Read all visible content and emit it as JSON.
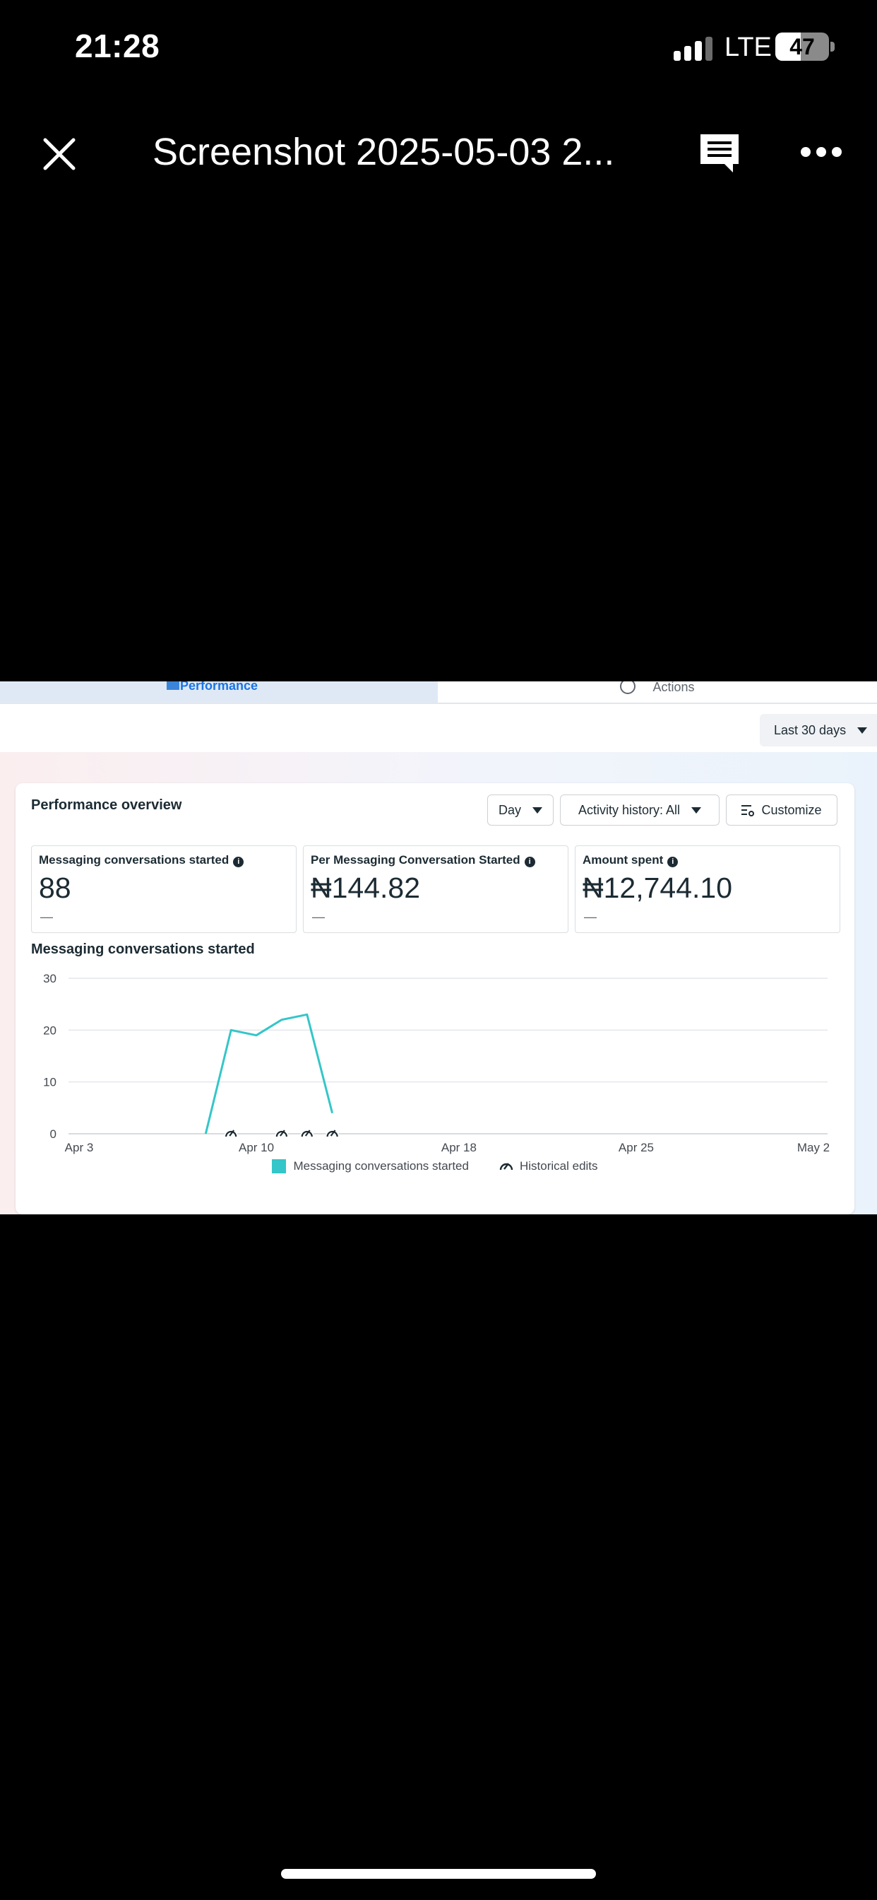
{
  "status_bar": {
    "time": "21:28",
    "network": "LTE",
    "battery": "47",
    "battery_level_pct": 47
  },
  "viewer": {
    "title": "Screenshot 2025-05-03 2...",
    "icons": [
      "close-icon",
      "comment-icon",
      "more-icon"
    ]
  },
  "tabs": [
    {
      "label": "Performance",
      "icon": "bar-chart-icon",
      "active": true
    },
    {
      "label": "Actions",
      "icon": "arrow-up-circle-icon",
      "active": false
    }
  ],
  "date_range": "Last 30 days",
  "overview": {
    "title": "Performance overview",
    "granularity": "Day",
    "activity": "Activity history: All",
    "customize": "Customize"
  },
  "metrics": [
    {
      "label": "Messaging conversations started",
      "value": "88",
      "compare": "—"
    },
    {
      "label": "Per Messaging Conversation Started",
      "value": "₦144.82",
      "compare": "—"
    },
    {
      "label": "Amount spent",
      "value": "₦12,744.10",
      "compare": "—"
    }
  ],
  "chart_data": {
    "type": "line",
    "title": "Messaging conversations started",
    "x_tick_labels": [
      "Apr 3",
      "Apr 10",
      "Apr 18",
      "Apr 25",
      "May 2"
    ],
    "y_ticks": [
      0,
      10,
      20,
      30
    ],
    "ylim": [
      0,
      30
    ],
    "grid": true,
    "series": [
      {
        "name": "Messaging conversations started",
        "color": "#34c6c8",
        "x": [
          "Apr 8",
          "Apr 9",
          "Apr 10",
          "Apr 11",
          "Apr 12",
          "Apr 13"
        ],
        "values": [
          0,
          20,
          19,
          22,
          23,
          4
        ]
      }
    ],
    "historical_edits": [
      "Apr 9",
      "Apr 11",
      "Apr 12",
      "Apr 13"
    ],
    "legend": [
      "Messaging conversations started",
      "Historical edits"
    ],
    "legend_position": "bottom"
  }
}
